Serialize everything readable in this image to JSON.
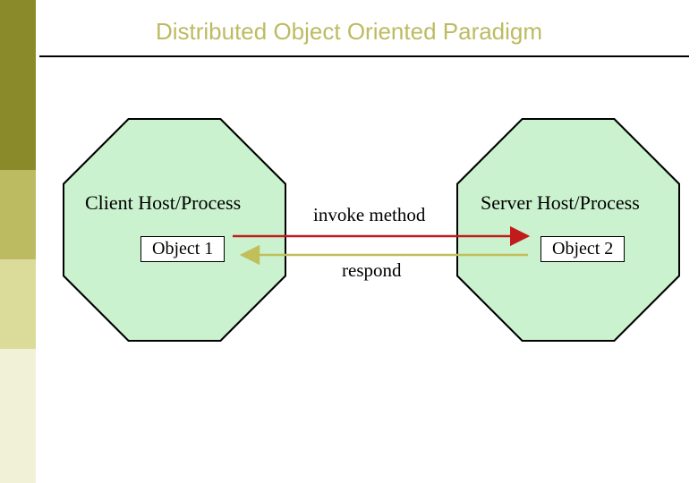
{
  "title": "Distributed Object Oriented Paradigm",
  "left_host": {
    "label": "Client Host/Process",
    "object": "Object 1"
  },
  "right_host": {
    "label": "Server Host/Process",
    "object": "Object 2"
  },
  "arrows": {
    "invoke": "invoke method",
    "respond": "respond"
  },
  "colors": {
    "title": "#bcbb62",
    "octagon_fill": "#caf2ce",
    "arrow_invoke": "#c21b1b",
    "arrow_respond": "#c0bf5b",
    "sidebar": [
      "#8b8a2a",
      "#bcbb62",
      "#dbdb9a",
      "#f1f1d7"
    ]
  }
}
